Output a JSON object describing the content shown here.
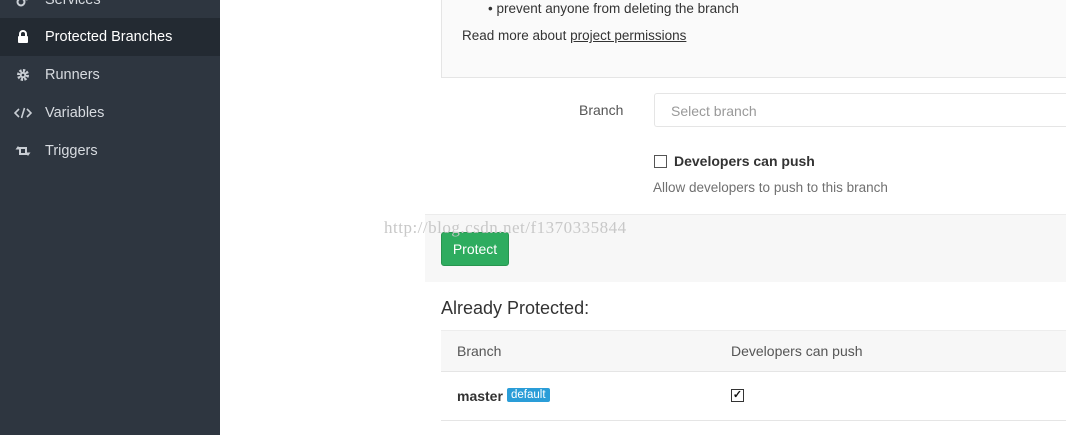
{
  "sidebar": {
    "items": [
      {
        "label": "Services",
        "icon": "cogs-icon"
      },
      {
        "label": "Protected Branches",
        "icon": "lock-icon",
        "active": true
      },
      {
        "label": "Runners",
        "icon": "gear-icon"
      },
      {
        "label": "Variables",
        "icon": "code-icon"
      },
      {
        "label": "Triggers",
        "icon": "retweet-icon"
      }
    ]
  },
  "info": {
    "bullet": "prevent anyone from deleting the branch",
    "readmore_prefix": "Read more about",
    "readmore_link": "project permissions"
  },
  "form": {
    "branch_label": "Branch",
    "branch_placeholder": "Select branch",
    "checkbox_label": "Developers can push",
    "checkbox_checked": false,
    "help_text": "Allow developers to push to this branch",
    "protect_button": "Protect"
  },
  "watermark": "http://blog.csdn.net/f1370335844",
  "protected": {
    "title": "Already Protected:",
    "columns": [
      "Branch",
      "Developers can push"
    ],
    "rows": [
      {
        "branch": "master",
        "badge": "default",
        "developers_can_push": true
      }
    ]
  },
  "colors": {
    "sidebar_bg": "#2e3640",
    "sidebar_active_bg": "#232a32",
    "protect_button": "#2eac5f",
    "badge": "#2a9dd8"
  }
}
